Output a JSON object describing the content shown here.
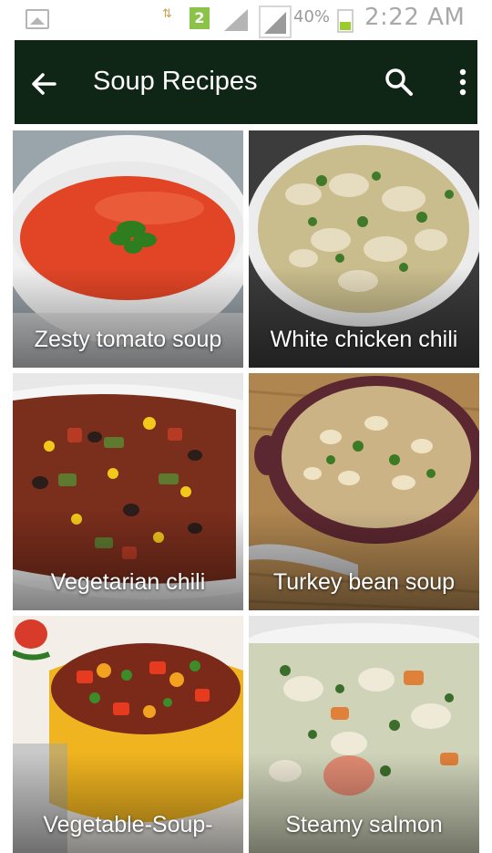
{
  "status_bar": {
    "battery_text": "40%",
    "time": "2:22 AM",
    "notification_count": "2",
    "data_indicator": "⇅"
  },
  "toolbar": {
    "title": "Soup Recipes",
    "background_color": "#0f2516"
  },
  "recipes": [
    {
      "title": "Zesty tomato soup"
    },
    {
      "title": "White chicken chili"
    },
    {
      "title": "Vegetarian chili"
    },
    {
      "title": "Turkey bean soup"
    },
    {
      "title": "Vegetable-Soup-"
    },
    {
      "title": "Steamy salmon"
    }
  ]
}
